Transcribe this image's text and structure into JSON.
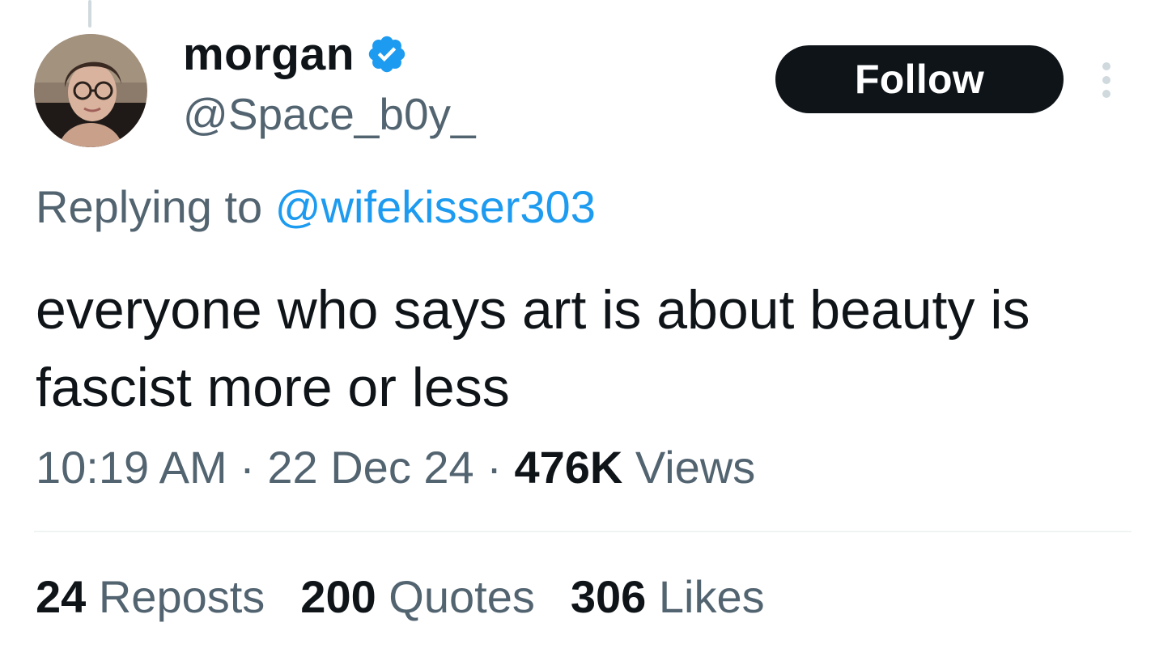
{
  "tweet": {
    "author": {
      "display_name": "morgan",
      "handle": "@Space_b0y_",
      "verified_icon": "verified-badge-icon",
      "avatar_icon": "avatar-photo"
    },
    "follow_label": "Follow",
    "more_icon": "more-options-icon",
    "reply_prefix": "Replying to",
    "reply_handle": "@wifekisser303",
    "text_lines": [
      "everyone who says art is about beauty is",
      "fascist more or less"
    ],
    "time": "10:19 AM",
    "date": "22 Dec 24",
    "separator": "·",
    "views_count": "476K",
    "views_label": "Views",
    "stats": [
      {
        "count": "24",
        "label": "Reposts"
      },
      {
        "count": "200",
        "label": "Quotes"
      },
      {
        "count": "306",
        "label": "Likes"
      }
    ]
  },
  "colors": {
    "text_primary": "#0f1419",
    "text_secondary": "#536471",
    "accent": "#1d9bf0",
    "follow_bg": "#0f1419",
    "divider": "#eff3f4"
  }
}
